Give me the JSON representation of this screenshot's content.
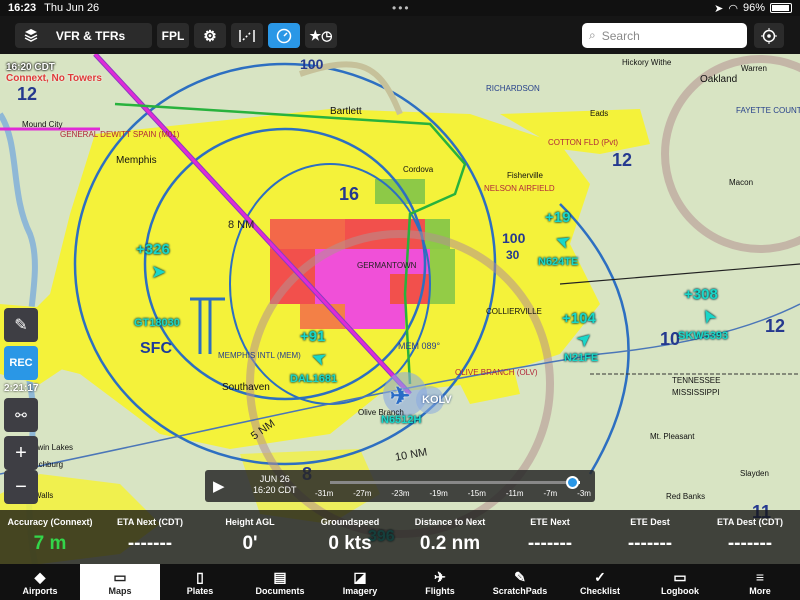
{
  "status_bar": {
    "time": "16:23",
    "date": "Thu Jun 26",
    "battery": "96%",
    "battery_level": 0.96
  },
  "toolbar": {
    "layers_label": "VFR & TFRs",
    "fpl_label": "FPL",
    "search_placeholder": "Search",
    "icons": [
      "layers-icon",
      "gear-icon",
      "route-icon",
      "gauge-icon",
      "star-clock-icon",
      "target-icon"
    ]
  },
  "map": {
    "overlay_time": "16:20 CDT",
    "overlay_status": "Connext, No Towers",
    "places": {
      "memphis": "Memphis",
      "bartlett": "Bartlett",
      "southaven": "Southaven",
      "olive_branch": "Olive Branch",
      "collierville": "COLLIERVILLE",
      "germantown": "GERMANTOWN",
      "tennessee": "TENNESSEE",
      "mississippi": "MISSISSIPPI",
      "oakland": "Oakland",
      "cordova": "Cordova",
      "fisherville": "Fisherville",
      "twin_lakes": "Twin Lakes",
      "lynchburg": "Lynchburg",
      "mt_pleasant": "Mt. Pleasant",
      "walls": "Walls",
      "mound_city": "Mound City",
      "warren": "Warren",
      "hickory_withe": "Hickory Withe",
      "eads": "Eads",
      "macon": "Macon",
      "slayden": "Slayden",
      "red_banks": "Red Banks"
    },
    "airports": {
      "general_dewitt": "GENERAL DEWITT SPAIN (M01)",
      "richardson": "RICHARDSON",
      "nelson": "NELSON AIRFIELD",
      "fayette": "FAYETTE COUNTY (FYE)",
      "olive_branch_apt": "OLIVE BRANCH (OLV)",
      "memphis_intl": "MEMPHIS INTL (MEM)",
      "cotton_fld": "COTTON FLD (Pvt)"
    },
    "grid_numbers": [
      "12",
      "16",
      "12",
      "10",
      "8",
      "100",
      "100",
      "30",
      "11",
      "12"
    ],
    "distance_labels": [
      "8 NM",
      "5 NM",
      "10 NM"
    ],
    "navaid": "MEM 089°",
    "ownship_tail": "N6512H",
    "ownship_airport": "KOLV",
    "traffic": [
      {
        "alt": "+326",
        "id": "GT18030"
      },
      {
        "alt": "+91",
        "id": "DAL1681"
      },
      {
        "alt": "+19",
        "id": "N624TE"
      },
      {
        "alt": "+104",
        "id": "N21FE"
      },
      {
        "alt": "+308",
        "id": "SKW5393"
      },
      {
        "alt": "396",
        "id": ""
      }
    ],
    "sfc_label": "SFC"
  },
  "side_controls": {
    "rec_label": "REC",
    "rec_time": "2:21:17",
    "zoom_in": "+",
    "zoom_out": "−"
  },
  "timebar": {
    "date": "JUN 26",
    "time": "16:20 CDT",
    "ticks": [
      "-31m",
      "-27m",
      "-23m",
      "-19m",
      "-15m",
      "-11m",
      "-7m",
      "-3m"
    ],
    "position": 0.97
  },
  "instruments": [
    {
      "label": "Accuracy (Connext)",
      "value": "7 m",
      "accent": "green"
    },
    {
      "label": "ETA Next (CDT)",
      "value": "-------"
    },
    {
      "label": "Height AGL",
      "value": "0'"
    },
    {
      "label": "Groundspeed",
      "value": "0 kts"
    },
    {
      "label": "Distance to Next",
      "value": "0.2 nm"
    },
    {
      "label": "ETE Next",
      "value": "-------"
    },
    {
      "label": "ETE Dest",
      "value": "-------"
    },
    {
      "label": "ETA Dest (CDT)",
      "value": "-------"
    }
  ],
  "tabs": [
    {
      "label": "Airports",
      "icon": "airports-icon",
      "glyph": "◆"
    },
    {
      "label": "Maps",
      "icon": "maps-icon",
      "glyph": "▭"
    },
    {
      "label": "Plates",
      "icon": "plates-icon",
      "glyph": "▯"
    },
    {
      "label": "Documents",
      "icon": "documents-icon",
      "glyph": "▤"
    },
    {
      "label": "Imagery",
      "icon": "imagery-icon",
      "glyph": "◪"
    },
    {
      "label": "Flights",
      "icon": "flights-icon",
      "glyph": "✈"
    },
    {
      "label": "ScratchPads",
      "icon": "scratchpads-icon",
      "glyph": "✎"
    },
    {
      "label": "Checklist",
      "icon": "checklist-icon",
      "glyph": "✓"
    },
    {
      "label": "Logbook",
      "icon": "logbook-icon",
      "glyph": "▭"
    },
    {
      "label": "More",
      "icon": "more-icon",
      "glyph": "≡"
    }
  ],
  "colors": {
    "accent": "#2a97e6",
    "tfr_yellow": "#f4f23a",
    "traffic_cyan": "#19d7c9",
    "route_magenta": "#e02ad6",
    "radar_red": "#f2504c",
    "radar_pink": "#f050d8",
    "radar_green": "#7ac24a",
    "status_green": "#33d64a"
  }
}
